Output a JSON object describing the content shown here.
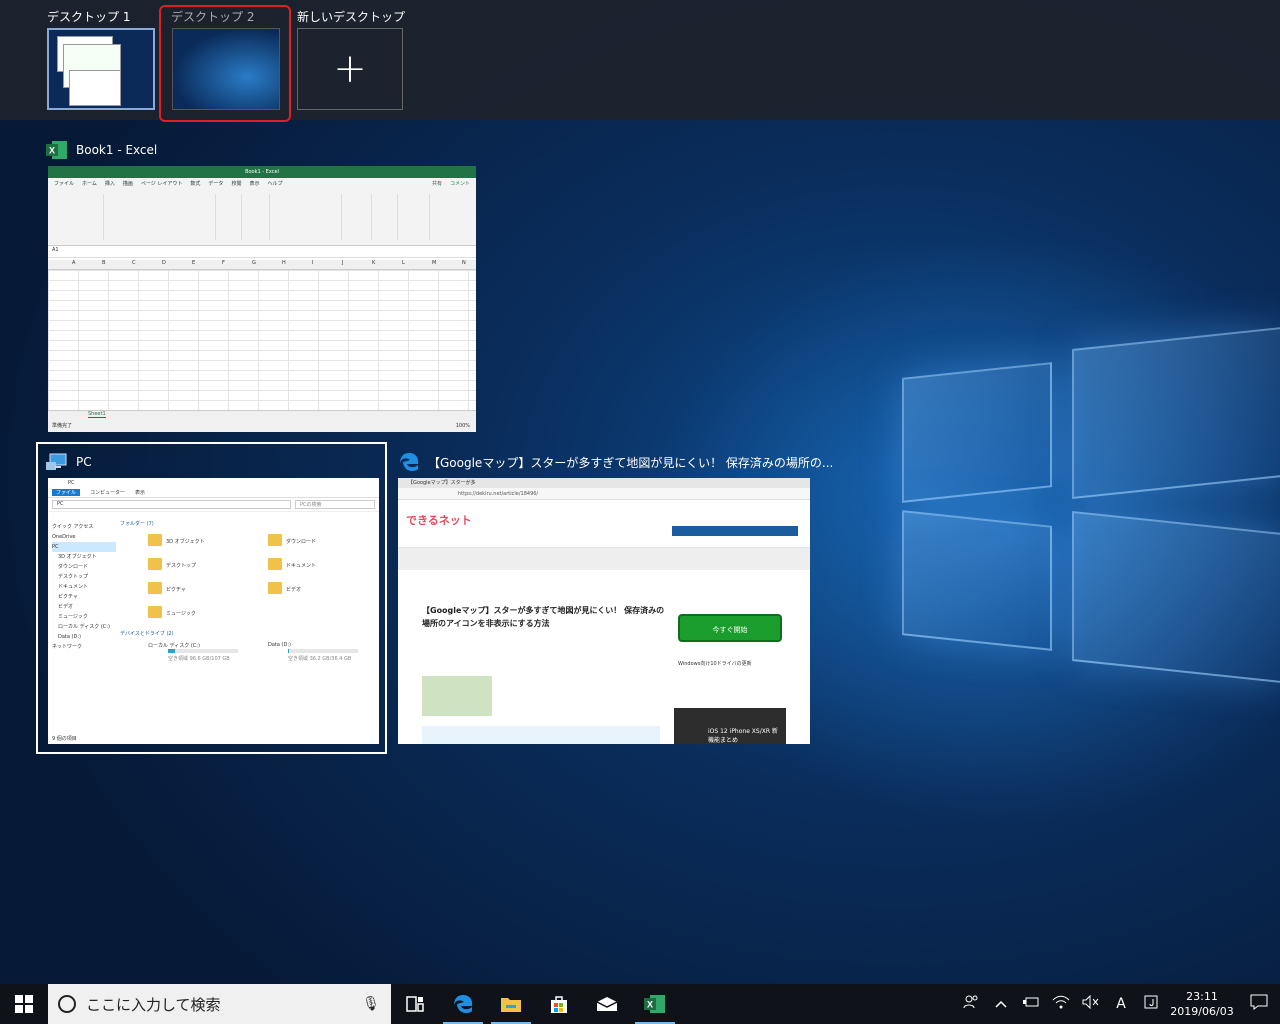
{
  "desktops": [
    {
      "label": "デスクトップ 1"
    },
    {
      "label": "デスクトップ 2"
    },
    {
      "label": "新しいデスクトップ",
      "icon": "plus"
    }
  ],
  "windows": {
    "excel": {
      "title": "Book1 - Excel",
      "titlebar": "Book1 - Excel",
      "menu": [
        "ファイル",
        "ホーム",
        "挿入",
        "描画",
        "ページ レイアウト",
        "数式",
        "データ",
        "校閲",
        "表示",
        "ヘルプ"
      ],
      "share": "共有",
      "comments": "コメント",
      "name_box": "A1",
      "columns": [
        "A",
        "B",
        "C",
        "D",
        "E",
        "F",
        "G",
        "H",
        "I",
        "J",
        "K",
        "L",
        "M",
        "N"
      ],
      "sheet_tab": "Sheet1",
      "status": "準備完了",
      "zoom": "100%"
    },
    "explorer": {
      "title": "PC",
      "menu": [
        "ファイル",
        "コンピューター",
        "表示"
      ],
      "address": "PC",
      "search_placeholder": "PCの検索",
      "nav": [
        "クイック アクセス",
        "OneDrive",
        "PC",
        "3D オブジェクト",
        "ダウンロード",
        "デスクトップ",
        "ドキュメント",
        "ピクチャ",
        "ビデオ",
        "ミュージック",
        "ローカル ディスク (C:)",
        "Data (D:)",
        "ネットワーク"
      ],
      "folders_header": "フォルダー (7)",
      "folders": [
        "3D オブジェクト",
        "ダウンロード",
        "デスクトップ",
        "ドキュメント",
        "ピクチャ",
        "ビデオ",
        "ミュージック"
      ],
      "drives_header": "デバイスとドライブ (2)",
      "drives": [
        {
          "name": "ローカル ディスク (C:)",
          "free": "空き領域 96.6 GB/107 GB",
          "used": 0.1
        },
        {
          "name": "Data (D:)",
          "free": "空き領域 36.2 GB/36.4 GB",
          "used": 0.01
        }
      ],
      "status": "9 個の項目"
    },
    "edge": {
      "title": "【Googleマップ】スターが多すぎて地図が見にくい！ 保存済みの場所の...",
      "tab": "【Googleマップ】スターが多",
      "url": "https://dekiru.net/article/18496/",
      "logo": "できるネット",
      "article_title": "【Googleマップ】スターが多すぎて地図が見にくい！ 保存済みの場所のアイコンを非表示にする方法",
      "cta": "今すぐ開始",
      "ad_text": "iOS 12 iPhone XS/XR 新機能まとめ",
      "sidebar_text": "Windows向け10ドライバの更新"
    }
  },
  "taskbar": {
    "search_placeholder": "ここに入力して検索",
    "ime": "A",
    "time": "23:11",
    "date": "2019/06/03"
  },
  "colors": {
    "selected_desktop_border": "#e02020",
    "excel_green": "#217346",
    "taskbar": "#0f1218",
    "accent": "#76b9ed"
  }
}
